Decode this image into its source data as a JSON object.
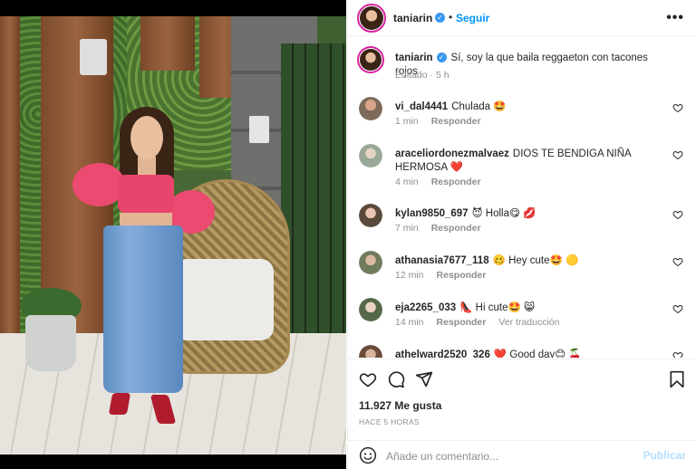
{
  "post": {
    "username": "taniarin",
    "follow_label": "Seguir",
    "more_label": "•••",
    "caption": "Sí, soy la que baila reggaeton con tacones rojos",
    "caption_meta": "Editado · 5 h"
  },
  "comments": [
    {
      "user": "vi_dal4441",
      "text": "Chulada 🤩",
      "time": "1 min",
      "reply": "Responder",
      "translate": ""
    },
    {
      "user": "araceliordonezmalvaez",
      "text": "DIOS TE BENDIGA NIÑA HERMOSA ❤️",
      "time": "4 min",
      "reply": "Responder",
      "translate": ""
    },
    {
      "user": "kylan9850_697",
      "text": "😈 Holla😋 💋",
      "time": "7 min",
      "reply": "Responder",
      "translate": ""
    },
    {
      "user": "athanasia7677_118",
      "text": "🥴 Hey cute🤩 🟡",
      "time": "12 min",
      "reply": "Responder",
      "translate": ""
    },
    {
      "user": "eja2265_033",
      "text": "👠 Hi cute🤩 😸",
      "time": "14 min",
      "reply": "Responder",
      "translate": "Ver traducción"
    },
    {
      "user": "athelward2520_326",
      "text": "❤️ Good day😊 🍒",
      "time": "",
      "reply": "",
      "translate": ""
    }
  ],
  "footer": {
    "likes": "11.927 Me gusta",
    "posted": "HACE 5 HORAS",
    "comment_placeholder": "Añade un comentario...",
    "publish_label": "Publicar"
  },
  "colors": {
    "accent": "#0095f6",
    "verified": "#3897f0",
    "muted": "#8e8e8e",
    "publish_disabled": "#b2dffc"
  },
  "icons": [
    "heart-icon",
    "comment-icon",
    "share-icon",
    "bookmark-icon",
    "emoji-icon",
    "verified-icon",
    "more-icon"
  ]
}
